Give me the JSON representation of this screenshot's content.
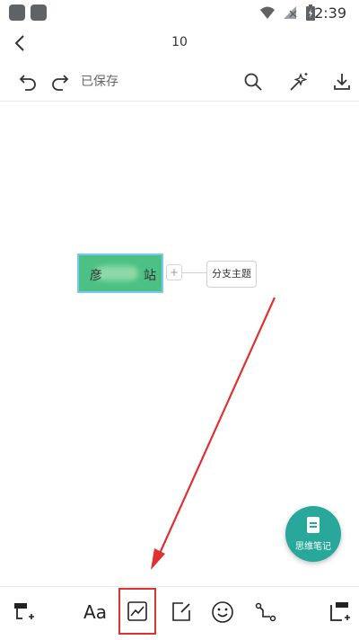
{
  "status_bar": {
    "time": "2:39"
  },
  "header": {
    "title": "10"
  },
  "toolbar": {
    "saved_label": "已保存"
  },
  "mindmap": {
    "root_prefix": "彦",
    "root_suffix": "站",
    "branch_label": "分支主题",
    "expand_symbol": "+"
  },
  "fab": {
    "label": "思维笔记"
  },
  "bottom_toolbar": {
    "text_style_label": "Aa"
  },
  "colors": {
    "root_fill": "#4dc185",
    "fab_bg": "#27a89a",
    "highlight": "#e03131",
    "arrow": "#e03131"
  }
}
